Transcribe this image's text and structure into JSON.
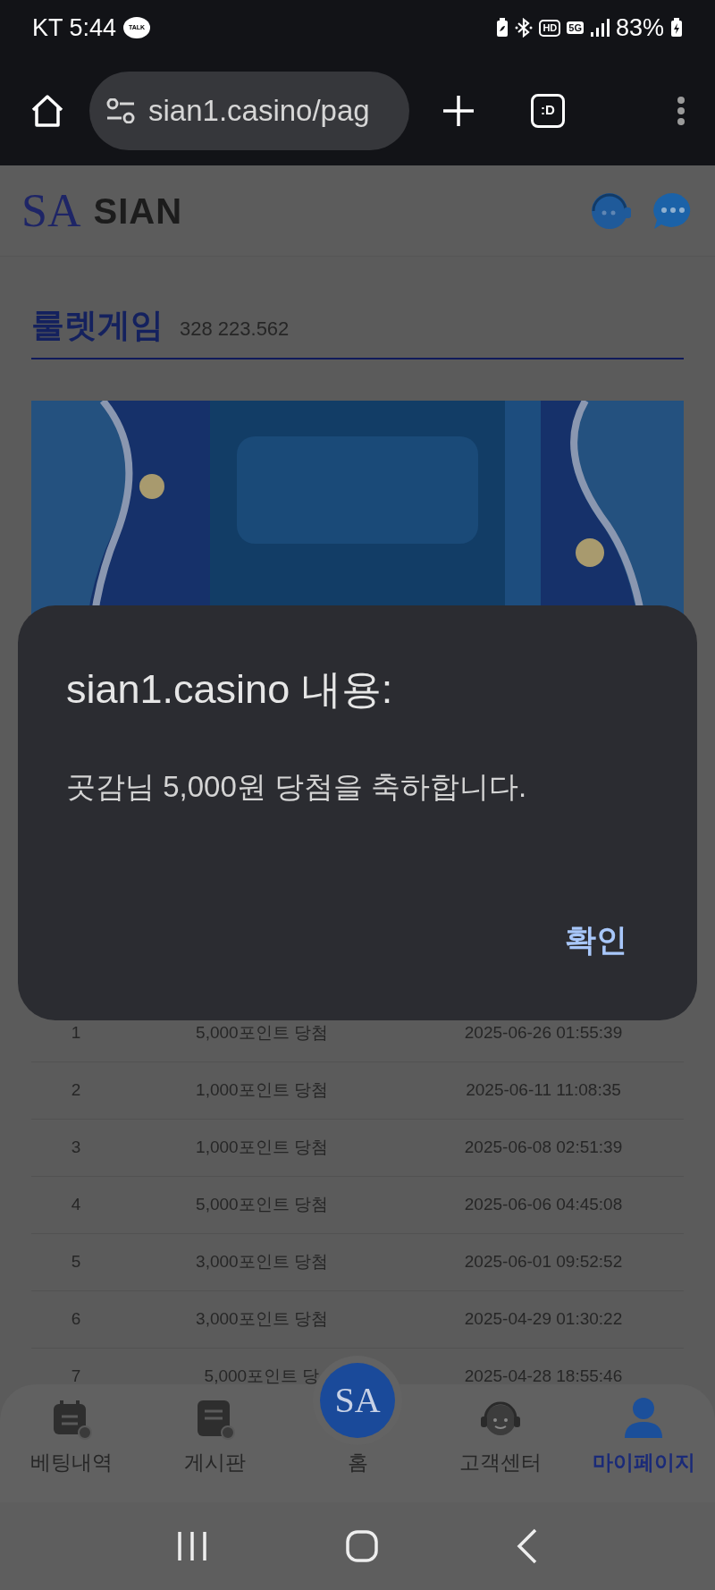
{
  "status_bar": {
    "carrier_time": "KT 5:44",
    "talk_badge": "TALK",
    "hd_badge": "HD",
    "network_badge": "5G",
    "battery": "83%"
  },
  "browser": {
    "url": "sian1.casino/pag",
    "tab_button": ":D"
  },
  "site_header": {
    "logo_monogram": "SA",
    "brand": "SIAN"
  },
  "page": {
    "title": "룰렛게임",
    "balance": "328 223.562"
  },
  "history": {
    "rows": [
      {
        "no": "1",
        "prize": "5,000포인트 당첨",
        "time": "2025-06-26 01:55:39"
      },
      {
        "no": "2",
        "prize": "1,000포인트 당첨",
        "time": "2025-06-11 11:08:35"
      },
      {
        "no": "3",
        "prize": "1,000포인트 당첨",
        "time": "2025-06-08 02:51:39"
      },
      {
        "no": "4",
        "prize": "5,000포인트 당첨",
        "time": "2025-06-06 04:45:08"
      },
      {
        "no": "5",
        "prize": "3,000포인트 당첨",
        "time": "2025-06-01 09:52:52"
      },
      {
        "no": "6",
        "prize": "3,000포인트 당첨",
        "time": "2025-04-29 01:30:22"
      },
      {
        "no": "7",
        "prize": "5,000포인트 당",
        "time": "2025-04-28 18:55:46"
      }
    ]
  },
  "bottom_nav": {
    "home_monogram": "SA",
    "items": [
      {
        "kind": "tab",
        "label": "베팅내역",
        "selected": false
      },
      {
        "kind": "tab",
        "label": "게시판",
        "selected": false
      },
      {
        "kind": "home",
        "label": "홈",
        "selected": false
      },
      {
        "kind": "tab",
        "label": "고객센터",
        "selected": false
      },
      {
        "kind": "tab",
        "label": "마이페이지",
        "selected": true
      }
    ]
  },
  "dialog": {
    "title": "sian1.casino 내용:",
    "message": "곳감님 5,000원 당첨을 축하합니다.",
    "button": "확인"
  }
}
